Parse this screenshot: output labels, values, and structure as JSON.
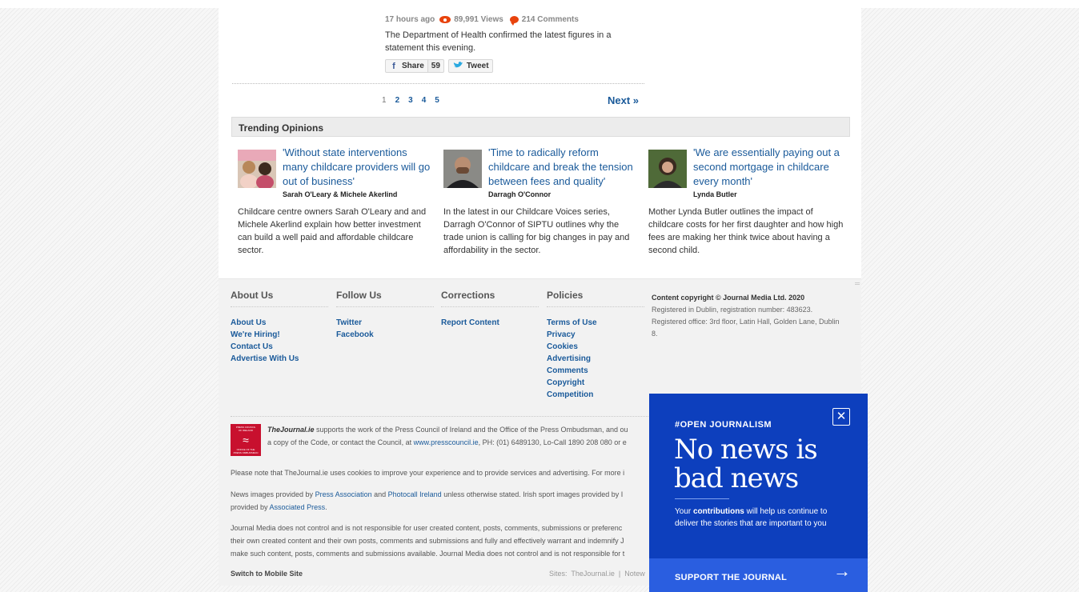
{
  "article": {
    "time": "17 hours ago",
    "views": "89,991 Views",
    "comments": "214 Comments",
    "excerpt": "The Department of Health confirmed the latest figures in a statement this evening.",
    "share_label": "Share",
    "share_count": "59",
    "tweet_label": "Tweet"
  },
  "pagination": {
    "current": "1",
    "pages": [
      "2",
      "3",
      "4",
      "5"
    ],
    "next": "Next »"
  },
  "trending": {
    "heading": "Trending Opinions",
    "items": [
      {
        "title": "'Without state interventions many childcare providers will go out of business'",
        "author": "Sarah O'Leary & Michele Akerlind",
        "desc": "Childcare centre owners Sarah O'Leary and and Michele Akerlind explain how better investment can build a well paid and affordable childcare sector."
      },
      {
        "title": "'Time to radically reform childcare and break the tension between fees and quality'",
        "author": "Darragh O'Connor",
        "desc": "In the latest in our Childcare Voices series, Darragh O'Connor of SIPTU outlines why the trade union is calling for big changes in pay and affordability in the sector."
      },
      {
        "title": "'We are essentially paying out a second mortgage in childcare every month'",
        "author": "Lynda Butler",
        "desc": "Mother Lynda Butler outlines the impact of childcare costs for her first daughter and how high fees are making her think twice about having a second child."
      }
    ]
  },
  "footer": {
    "columns": [
      {
        "heading": "About Us",
        "links": [
          "About Us",
          "We're Hiring!",
          "Contact Us",
          "Advertise With Us"
        ]
      },
      {
        "heading": "Follow Us",
        "links": [
          "Twitter",
          "Facebook"
        ]
      },
      {
        "heading": "Corrections",
        "links": [
          "Report Content"
        ]
      },
      {
        "heading": "Policies",
        "links": [
          "Terms of Use",
          "Privacy",
          "Cookies",
          "Advertising",
          "Comments",
          "Copyright",
          "Competition"
        ]
      }
    ],
    "copyright_title": "Content copyright © Journal Media Ltd. 2020",
    "copyright_body": "Registered in Dublin, registration number: 483623. Registered office: 3rd floor, Latin Hall, Golden Lane, Dublin 8.",
    "press_brand": "TheJournal.ie",
    "press_line1": " supports the work of the Press Council of Ireland and the Office of the Press Ombudsman, and ou",
    "press_line2_a": "a copy of the Code, or contact the Council, at ",
    "press_link": "www.presscouncil.ie",
    "press_line2_b": ", PH: (01) 6489130, Lo-Call 1890 208 080 or e",
    "cookies_note": "Please note that TheJournal.ie uses cookies to improve your experience and to provide services and advertising. For more i",
    "images_a": "News images provided by ",
    "images_link1": "Press Association",
    "images_b": " and ",
    "images_link2": "Photocall Ireland",
    "images_c": " unless otherwise stated. Irish sport images provided by I",
    "images_d": "provided by ",
    "images_link3": "Associated Press",
    "images_e": ".",
    "disclaimer1": "Journal Media does not control and is not responsible for user created content, posts, comments, submissions or preferenc",
    "disclaimer2": "their own created content and their own posts, comments and submissions and fully and effectively warrant and indemnify J",
    "disclaimer3": "make such content, posts, comments and submissions available. Journal Media does not control and is not responsible for t",
    "mobile_link": "Switch to Mobile Site",
    "sites_label": "Sites:",
    "sites_item1": "TheJournal.ie",
    "sites_sep": "|",
    "sites_item2": "Notew"
  },
  "press_logo_text": "PRESS COUNCIL OF IRELAND · OFFICE OF THE PRESS OMBUDSMAN",
  "promo": {
    "tag": "#OPEN JOURNALISM",
    "headline": "No news is bad news",
    "body_a": "Your ",
    "body_bold": "contributions",
    "body_b": " will help us continue to deliver the stories that are important to you",
    "cta": "SUPPORT THE JOURNAL",
    "close_icon": "close-icon",
    "arrow_icon": "arrow-right-icon"
  },
  "colors": {
    "link": "#1a5a9a",
    "accent": "#e8430d",
    "promo_bg": "#0d3fbd",
    "promo_cta": "#2a5ee0",
    "press_red": "#c8102e"
  }
}
